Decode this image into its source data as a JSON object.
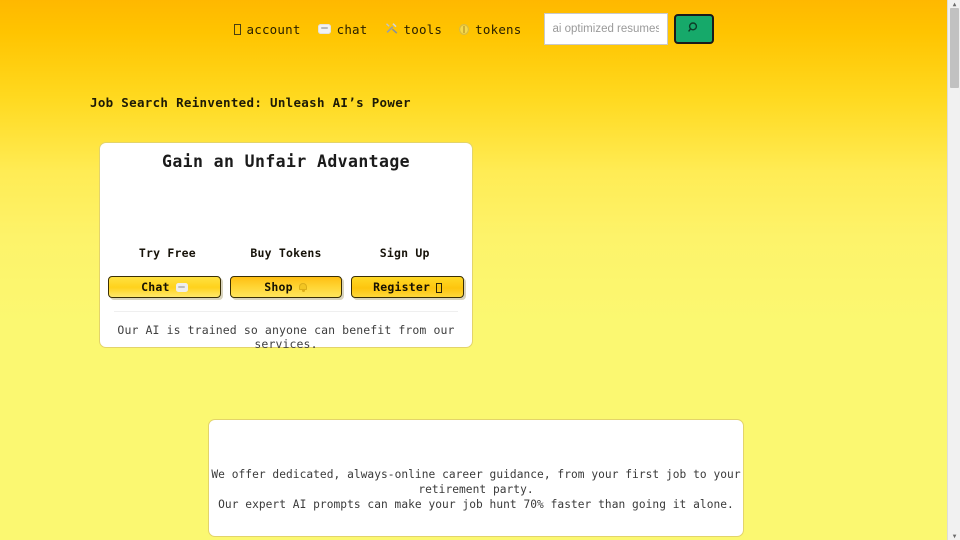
{
  "nav": {
    "links": [
      {
        "label": "account",
        "icon": "user-tofu-icon"
      },
      {
        "label": "chat",
        "icon": "speech-bubble-icon"
      },
      {
        "label": "tools",
        "icon": "hammer-and-wrench-icon"
      },
      {
        "label": "tokens",
        "icon": "coin-icon"
      }
    ],
    "search": {
      "value": "",
      "placeholder": "ai optimized resumes",
      "button_icon": "magnifier-icon",
      "button_color": "#16a96a"
    }
  },
  "page": {
    "headline": "Job Search Reinvented: Unleash AI’s Power",
    "background_top_color": "#ffb800",
    "background_bottom_color": "#fbf871"
  },
  "hero_card": {
    "title": "Gain an Unfair Advantage",
    "columns": [
      {
        "label": "Try Free",
        "button_text": "Chat",
        "button_icon": "speech-bubble-icon"
      },
      {
        "label": "Buy Tokens",
        "button_text": "Shop",
        "button_icon": "bell-icon"
      },
      {
        "label": "Sign Up",
        "button_text": "Register",
        "button_icon": "tofu-icon"
      }
    ],
    "footnote": "Our AI is trained so anyone can benefit from our services."
  },
  "info_card": {
    "line1": "We offer dedicated, always-online career guidance, from your first job to your retirement party.",
    "line2": "Our expert AI prompts can make your job hunt 70% faster than going it alone."
  },
  "scrollbar": {
    "up_arrow": "▲",
    "down_arrow": "▼"
  }
}
